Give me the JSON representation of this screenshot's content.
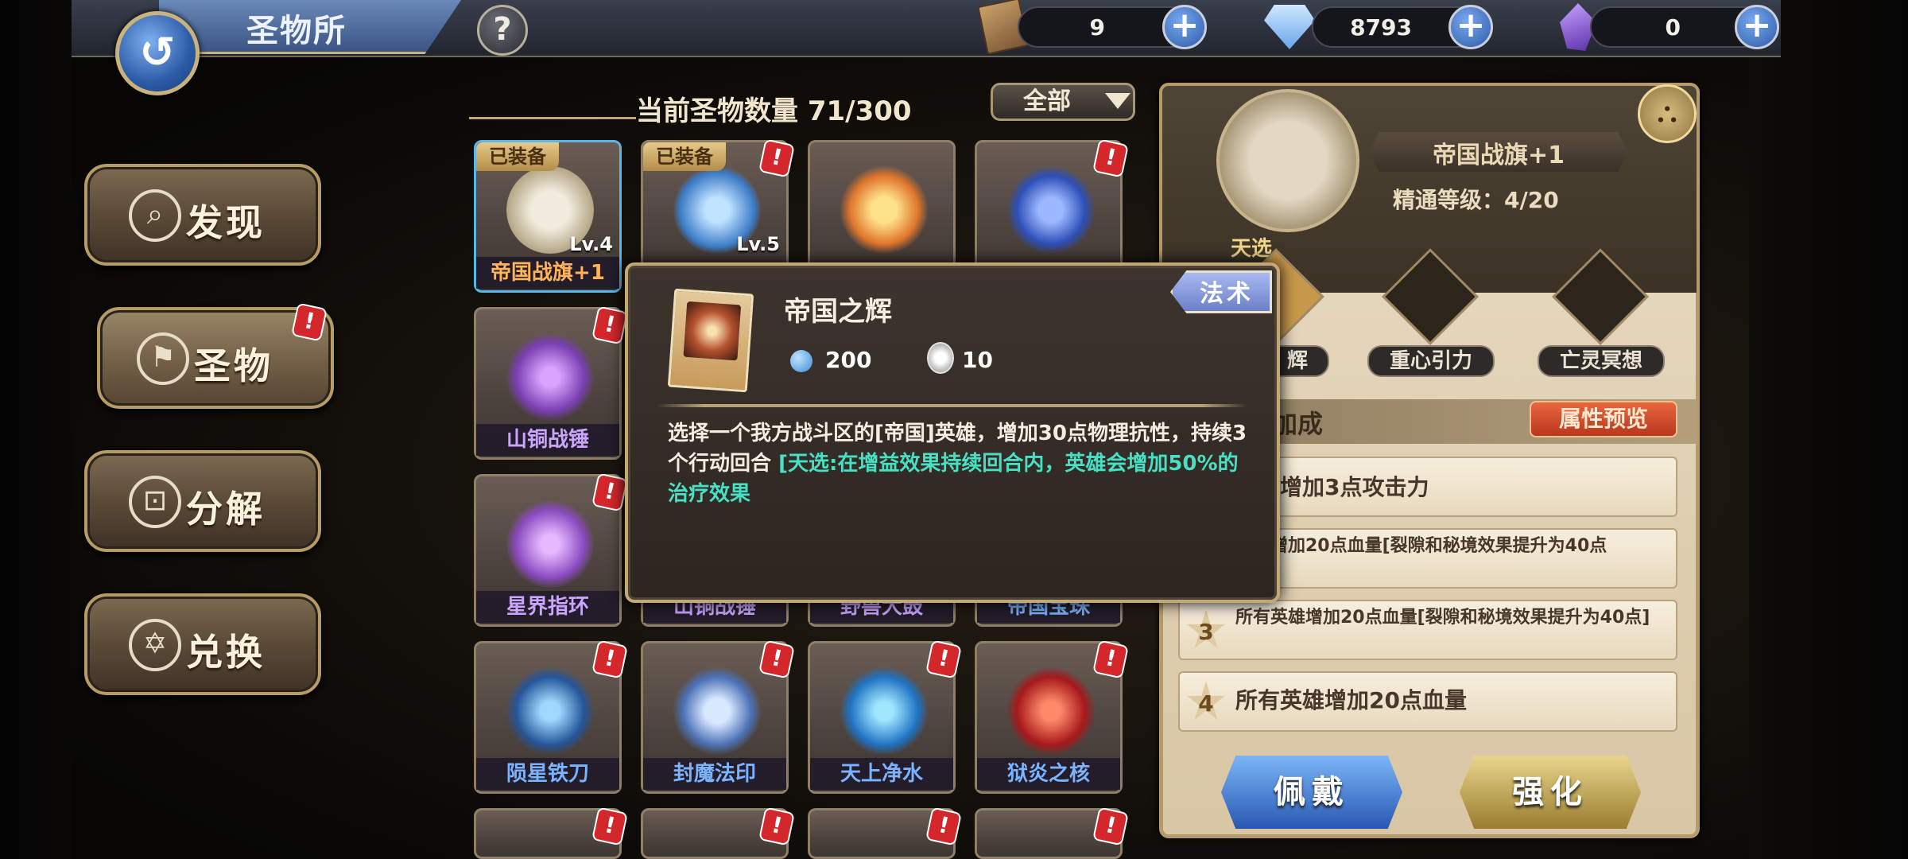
{
  "header": {
    "title": "圣物所",
    "help_label": "?",
    "resources": [
      {
        "icon": "scroll-icon",
        "value": "9"
      },
      {
        "icon": "gem-icon",
        "value": "8793"
      },
      {
        "icon": "crystal-icon",
        "value": "0"
      }
    ],
    "plus_label": "+"
  },
  "menu": {
    "items": [
      {
        "label": "发现",
        "icon": "search-icon"
      },
      {
        "label": "圣物",
        "icon": "relic-icon",
        "badge": "!"
      },
      {
        "label": "分解",
        "icon": "decompose-icon"
      },
      {
        "label": "兑换",
        "icon": "exchange-icon"
      }
    ]
  },
  "list": {
    "count_label": "当前圣物数量  71/300",
    "filter": "全部",
    "equipped_tag": "已装备",
    "badge": "!",
    "cards": [
      {
        "name": "帝国战旗+1",
        "level": "Lv.4",
        "equipped": true,
        "color": "orange"
      },
      {
        "name": "",
        "level": "Lv.5",
        "equipped": true,
        "color": "blue"
      },
      {
        "name": "",
        "level": "",
        "equipped": false,
        "color": "orange"
      },
      {
        "name": "",
        "level": "",
        "equipped": false,
        "color": "blue"
      },
      {
        "name": "山铜战锤",
        "level": "",
        "equipped": false,
        "color": "purple"
      },
      {
        "name": "星界指环",
        "level": "",
        "equipped": false,
        "color": "purple"
      },
      {
        "name": "山铜战锤",
        "level": "",
        "equipped": false,
        "color": "purple"
      },
      {
        "name": "野兽大鼓",
        "level": "",
        "equipped": false,
        "color": "purple"
      },
      {
        "name": "帝国宝珠",
        "level": "",
        "equipped": false,
        "color": "purple"
      },
      {
        "name": "陨星铁刀",
        "level": "",
        "equipped": false,
        "color": "blue"
      },
      {
        "name": "封魔法印",
        "level": "",
        "equipped": false,
        "color": "blue"
      },
      {
        "name": "天上净水",
        "level": "",
        "equipped": false,
        "color": "blue"
      },
      {
        "name": "狱炎之核",
        "level": "",
        "equipped": false,
        "color": "blue"
      }
    ]
  },
  "detail": {
    "relic_name": "帝国战旗+1",
    "mastery": "精通等级：4/20",
    "skill_header": "天选",
    "skills": [
      "辉",
      "重心引力",
      "亡灵冥想"
    ],
    "bonus_title": "加成",
    "preview_label": "属性预览",
    "bonuses": [
      {
        "num": "",
        "text": "英雄增加3点攻击力"
      },
      {
        "num": "",
        "text": "英雄增加20点血量[裂隙和秘境效果提升为40点"
      },
      {
        "num": "3",
        "text": "所有英雄增加20点血量[裂隙和秘境效果提升为40点]"
      },
      {
        "num": "4",
        "text": "所有英雄增加20点血量"
      }
    ],
    "wear_label": "佩戴",
    "upgrade_label": "强化"
  },
  "tooltip": {
    "name": "帝国之辉",
    "type": "法术",
    "cost": "200",
    "duration": "10",
    "desc_main": "选择一个我方战斗区的[帝国]英雄，增加30点物理抗性，持续3个行动回合 ",
    "desc_highlight": "[天选:在增益效果持续回合内，英雄会增加50%的治疗效果"
  },
  "colors": {
    "accent_gold": "#c7a666",
    "highlight_teal": "#48e0c4",
    "badge_red": "#d4272b"
  }
}
